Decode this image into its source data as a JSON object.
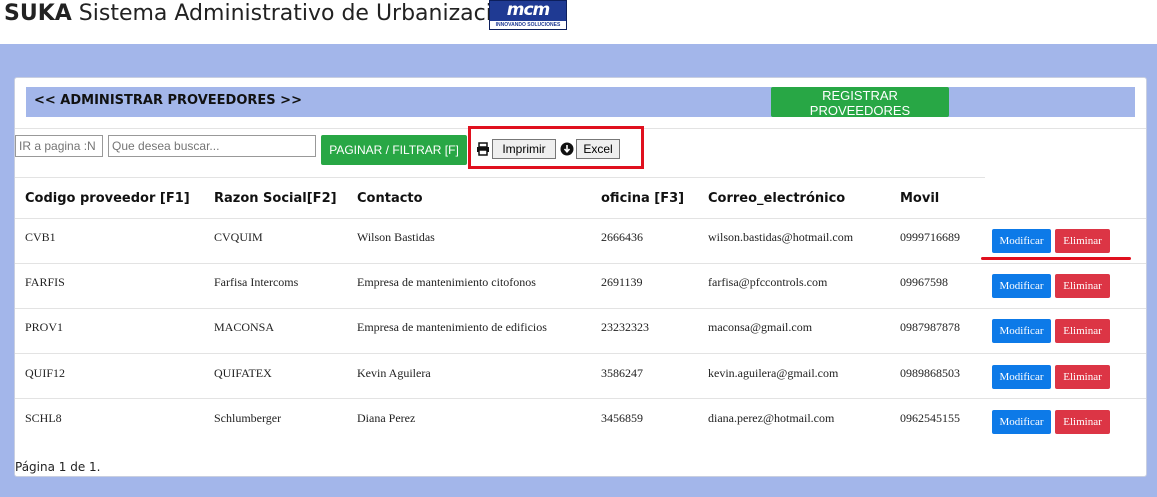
{
  "app": {
    "title_bold": "SUKA",
    "title_rest": " Sistema Administrativo de Urbanizaciones",
    "logo_mark": "mcm",
    "logo_tagline": "INNOVANDO SOLUCIONES"
  },
  "section": {
    "title": "<< ADMINISTRAR PROVEEDORES >>",
    "register_button": "REGISTRAR PROVEEDORES"
  },
  "filters": {
    "page_placeholder": "IR a pagina :N",
    "search_placeholder": "Que desea buscar...",
    "paginate_button": "PAGINAR / FILTRAR [F]",
    "print_button": "Imprimir",
    "excel_button": "Excel"
  },
  "table": {
    "columns": [
      "Codigo proveedor [F1]",
      "Razon Social[F2]",
      "Contacto",
      "oficina [F3]",
      "Correo_electrónico",
      "Movil"
    ],
    "rows": [
      {
        "codigo": "CVB1",
        "razon": "CVQUIM",
        "contacto": "Wilson Bastidas",
        "oficina": "2666436",
        "correo": "wilson.bastidas@hotmail.com",
        "movil": "0999716689"
      },
      {
        "codigo": "FARFIS",
        "razon": "Farfisa Intercoms",
        "contacto": "Empresa de mantenimiento citofonos",
        "oficina": "2691139",
        "correo": "farfisa@pfccontrols.com",
        "movil": "09967598"
      },
      {
        "codigo": "PROV1",
        "razon": "MACONSA",
        "contacto": "Empresa de mantenimiento de edificios",
        "oficina": "23232323",
        "correo": "maconsa@gmail.com",
        "movil": "0987987878"
      },
      {
        "codigo": "QUIF12",
        "razon": "QUIFATEX",
        "contacto": "Kevin Aguilera",
        "oficina": "3586247",
        "correo": "kevin.aguilera@gmail.com",
        "movil": "0989868503"
      },
      {
        "codigo": "SCHL8",
        "razon": "Schlumberger",
        "contacto": "Diana Perez",
        "oficina": "3456859",
        "correo": "diana.perez@hotmail.com",
        "movil": "0962545155"
      }
    ],
    "modify_label": "Modificar",
    "delete_label": "Eliminar"
  },
  "footer": {
    "page_info": "Página 1 de 1."
  },
  "colors": {
    "band": "#a3b6ea",
    "green": "#28a745",
    "blue": "#0d7ae8",
    "red": "#dc3545",
    "highlight": "#e0101e"
  }
}
